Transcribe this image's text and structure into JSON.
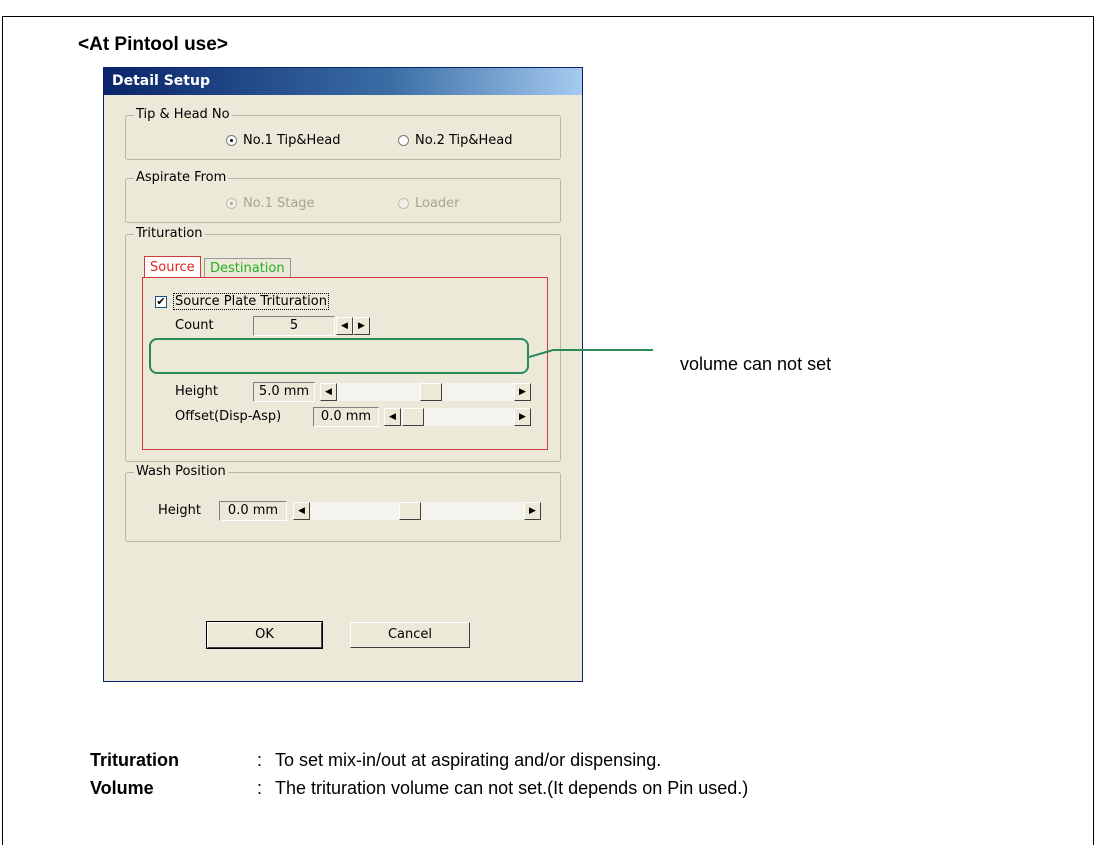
{
  "heading": "<At Pintool use>",
  "dialog": {
    "title": "Detail Setup",
    "tip_group": {
      "legend": "Tip & Head No",
      "options": [
        "No.1 Tip&Head",
        "No.2 Tip&Head"
      ],
      "selected_index": 0
    },
    "aspirate_group": {
      "legend": "Aspirate From",
      "options": [
        "No.1 Stage",
        "Loader"
      ],
      "selected_index": 0,
      "disabled": true
    },
    "trituration_group": {
      "legend": "Trituration",
      "tabs": [
        "Source",
        "Destination"
      ],
      "tab_colors": {
        "source": "#e02020",
        "destination": "#20b020"
      },
      "checkbox_label": "Source Plate Trituration",
      "checkbox_checked": true,
      "count_label": "Count",
      "count_value": "5",
      "height_label": "Height",
      "height_value": "5.0 mm",
      "offset_label": "Offset(Disp-Asp)",
      "offset_value": "0.0 mm"
    },
    "wash_group": {
      "legend": "Wash Position",
      "height_label": "Height",
      "height_value": "0.0 mm"
    },
    "ok_label": "OK",
    "cancel_label": "Cancel"
  },
  "annotation": {
    "text": "volume can not set",
    "color": "#2a8a5a"
  },
  "descriptions": [
    {
      "term": "Trituration",
      "sep": ":",
      "text": "To set mix-in/out at aspirating and/or dispensing."
    },
    {
      "term": "Volume",
      "sep": ":",
      "text": "The trituration volume can not set.(It depends on Pin used.)"
    }
  ]
}
